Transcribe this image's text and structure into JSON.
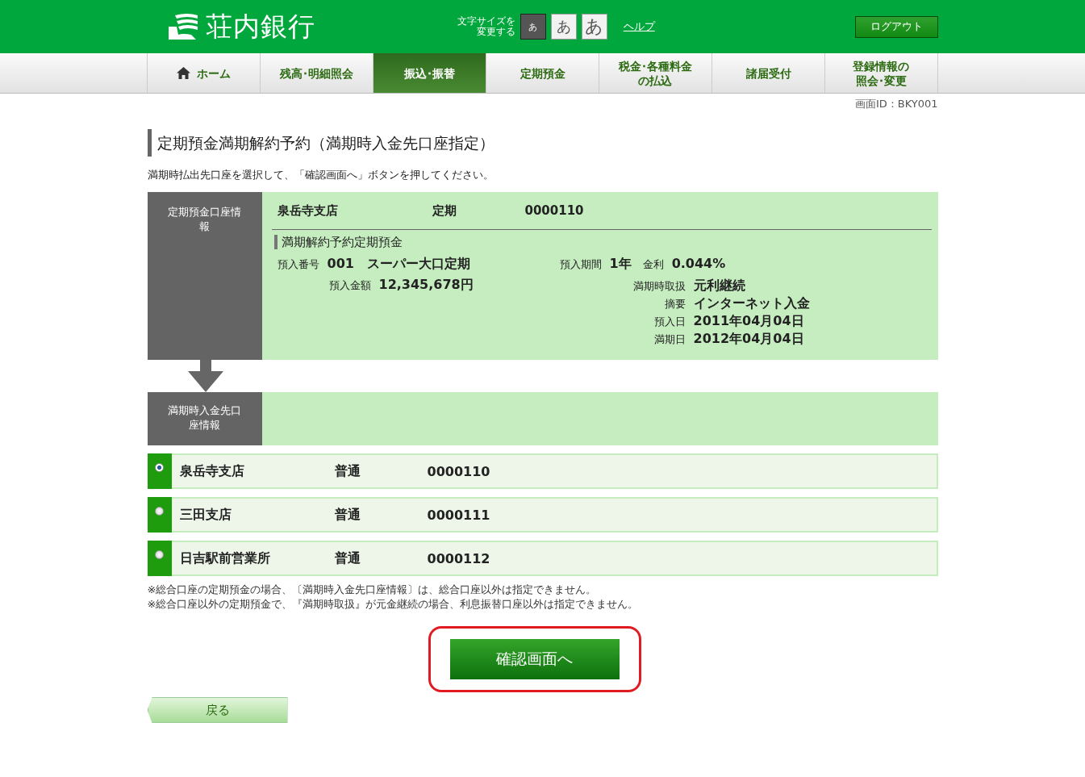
{
  "header": {
    "bank_name": "荘内銀行",
    "font_size_label": "文字サイズを変更する",
    "font_sizes": [
      {
        "label": "あ",
        "selected": true
      },
      {
        "label": "あ",
        "selected": false
      },
      {
        "label": "あ",
        "selected": false
      }
    ],
    "help_link": "ヘルプ",
    "logout_button": "ログアウト"
  },
  "nav": [
    {
      "label": "ホーム",
      "kind": "home",
      "selected": false
    },
    {
      "label": "残高･明細照会",
      "selected": false
    },
    {
      "label": "振込･振替",
      "selected": true
    },
    {
      "label": "定期預金",
      "selected": false
    },
    {
      "label": "税金･各種料金の払込",
      "selected": false
    },
    {
      "label": "諸届受付",
      "selected": false
    },
    {
      "label": "登録情報の照会･変更",
      "selected": false
    }
  ],
  "screen_id": "画面ID：BKY001",
  "page_title": "定期預金満期解約予約（満期時入金先口座指定）",
  "instruction": "満期時払出先口座を選択して、「確認画面へ」ボタンを押してください。",
  "deposit_info": {
    "label": "定期預金口座情報",
    "branch": "泉岳寺支店",
    "type": "定期",
    "number": "0000110",
    "subtitle": "満期解約予約定期預金",
    "left_fields": [
      {
        "label": "預入番号",
        "value": "001　スーパー大口定期"
      },
      {
        "label": "預入金額",
        "value": "12,345,678円"
      }
    ],
    "term_label": "預入期間",
    "term": "1年",
    "rate_label": "金利",
    "rate": "0.044%",
    "right_fields": [
      {
        "label": "満期時取扱",
        "value": "元利継続"
      },
      {
        "label": "摘要",
        "value": "インターネット入金"
      },
      {
        "label": "預入日",
        "value": "2011年04月04日"
      },
      {
        "label": "満期日",
        "value": "2012年04月04日"
      }
    ]
  },
  "destination": {
    "label": "満期時入金先口座情報",
    "accounts": [
      {
        "branch": "泉岳寺支店",
        "type": "普通",
        "number": "0000110",
        "selected": true
      },
      {
        "branch": "三田支店",
        "type": "普通",
        "number": "0000111",
        "selected": false
      },
      {
        "branch": "日吉駅前営業所",
        "type": "普通",
        "number": "0000112",
        "selected": false
      }
    ]
  },
  "notes": [
    "※総合口座の定期預金の場合、〔満期時入金先口座情報〕は、総合口座以外は指定できません。",
    "※総合口座以外の定期預金で、『満期時取扱』が元金継続の場合、利息振替口座以外は指定できません。"
  ],
  "confirm_button": "確認画面へ",
  "confirm_highlighted": true,
  "back_button": "戻る"
}
